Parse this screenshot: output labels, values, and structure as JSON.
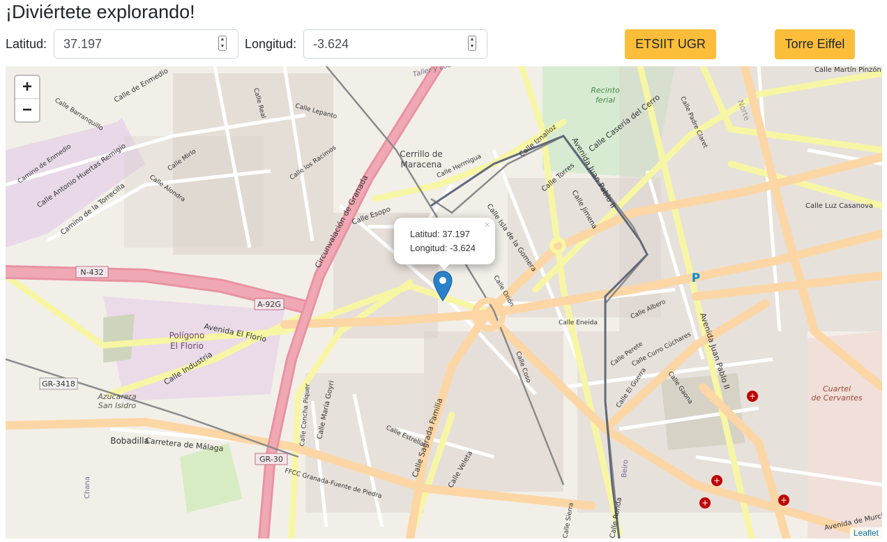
{
  "header": {
    "title": "¡Diviértete explorando!"
  },
  "form": {
    "lat_label": "Latitud:",
    "lat_value": "37.197",
    "lng_label": "Longitud:",
    "lng_value": "-3.624",
    "btn_etsiit": "ETSIIT UGR",
    "btn_eiffel": "Torre Eiffel"
  },
  "map": {
    "zoom_in": "+",
    "zoom_out": "−",
    "popup": {
      "lat_line": "Latitud: 37.197",
      "lng_line": "Longitud: -3.624",
      "close": "×"
    },
    "attribution": "Leaflet",
    "labels": {
      "recinto": "Recinto",
      "ferial": "ferial",
      "cerrillo": "Cerrillo de",
      "maracena": "Maracena",
      "poligono": "Polígono",
      "florio": "El Florio",
      "azucarera": "Azucarera",
      "san_isidro": "San Isidro",
      "bobadilla": "Bobadilla",
      "cuartel": "Cuartel",
      "cervantes": "de Cervantes",
      "parking": "P",
      "taller": "Taller y cocheras",
      "n432": "N-432",
      "a92g": "A-92G",
      "gr3418": "GR-3418",
      "gr30": "GR-30",
      "circunvalacion": "Circunvalación de Granada",
      "av_florio": "Avenida El Florio",
      "c_industria": "Calle Industria",
      "carretera_malaga": "Carretera de Málaga",
      "camino_torrecilla": "Camino de la Torrecilla",
      "c_huertas": "Calle Antonio Huertas Remigio",
      "c_enmedio": "Calle de Enmedio",
      "camino_enmedio": "Camino de Enmedio",
      "c_barranquillo": "Calle Barranquillo",
      "c_real": "Calle Real",
      "c_lepanto": "Calle Lepanto",
      "c_racimos": "Calle los Racimos",
      "c_mirlo": "Calle Mirlo",
      "c_alondra": "Calle Alondra",
      "c_esopo": "Calle Esopo",
      "c_hermigua": "Calle Hermigua",
      "c_isla_gomera": "Calle Isla de la Gomera",
      "c_iznalloz": "Calle Iznalloz",
      "c_torres": "Calle Torres",
      "c_jimena": "Calle Jimena",
      "c_caseria": "Calle Casería del Cerro",
      "av_juan_pablo": "Avenida Juan Pablo II",
      "c_martin_pinzon": "Calle Martín Pinzón",
      "c_luz_casanova": "Calle Luz Casanova",
      "c_padre_claret": "Calle Padre Claret",
      "c_albero": "Calle Albero",
      "c_eneida": "Calle Eneida",
      "c_orion": "Calle Orión",
      "c_coso": "Calle Coso",
      "c_perete": "Calle Perete",
      "c_curro_cuchares": "Calle Curro Cúchares",
      "c_guerra": "Calle El Guerra",
      "c_gaona": "Calle Gaona",
      "c_sagrada_familia": "Calle Sagrada Familia",
      "c_veleta": "Calle Veleta",
      "c_estrellas": "Calle Estrellas",
      "c_maria_goyri": "Calle María Goyri",
      "c_concha": "Calle Concha Piquer",
      "av_murcia": "Avenida de Murcia",
      "c_ronda": "Calle Ronda",
      "c_sierra": "Calle Sierra",
      "ffcc": "FFCC Granada-Fuente de Piedra",
      "norte": "Norte",
      "chana": "Chana",
      "beiro": "Beiro"
    }
  }
}
